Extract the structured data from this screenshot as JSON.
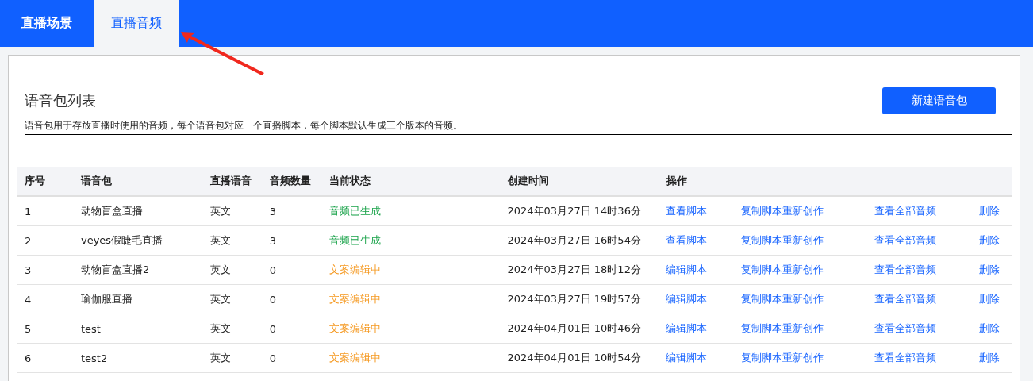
{
  "tabs": [
    {
      "label": "直播场景",
      "selected": false
    },
    {
      "label": "直播音频",
      "selected": true
    }
  ],
  "panel": {
    "title": "语音包列表",
    "description": "语音包用于存放直播时使用的音频，每个语音包对应一个直播脚本，每个脚本默认生成三个版本的音频。",
    "new_button": "新建语音包"
  },
  "table": {
    "columns": [
      "序号",
      "语音包",
      "直播语音",
      "音频数量",
      "当前状态",
      "创建时间",
      "操作"
    ],
    "rows": [
      {
        "index": "1",
        "name": "动物盲盒直播",
        "language": "英文",
        "count": "3",
        "status": {
          "kind": "done",
          "text": "音频已生成"
        },
        "created": "2024年03月27日 14时36分",
        "actions": [
          "查看脚本",
          "复制脚本重新创作",
          "查看全部音频",
          "删除"
        ]
      },
      {
        "index": "2",
        "name": "veyes假睫毛直播",
        "language": "英文",
        "count": "3",
        "status": {
          "kind": "done",
          "text": "音频已生成"
        },
        "created": "2024年03月27日 16时54分",
        "actions": [
          "查看脚本",
          "复制脚本重新创作",
          "查看全部音频",
          "删除"
        ]
      },
      {
        "index": "3",
        "name": "动物盲盒直播2",
        "language": "英文",
        "count": "0",
        "status": {
          "kind": "editing",
          "text": "文案编辑中"
        },
        "created": "2024年03月27日 18时12分",
        "actions": [
          "编辑脚本",
          "复制脚本重新创作",
          "查看全部音频",
          "删除"
        ]
      },
      {
        "index": "4",
        "name": "瑜伽服直播",
        "language": "英文",
        "count": "0",
        "status": {
          "kind": "editing",
          "text": "文案编辑中"
        },
        "created": "2024年03月27日 19时57分",
        "actions": [
          "编辑脚本",
          "复制脚本重新创作",
          "查看全部音频",
          "删除"
        ]
      },
      {
        "index": "5",
        "name": "test",
        "language": "英文",
        "count": "0",
        "status": {
          "kind": "editing",
          "text": "文案编辑中"
        },
        "created": "2024年04月01日 10时46分",
        "actions": [
          "编辑脚本",
          "复制脚本重新创作",
          "查看全部音频",
          "删除"
        ]
      },
      {
        "index": "6",
        "name": "test2",
        "language": "英文",
        "count": "0",
        "status": {
          "kind": "editing",
          "text": "文案编辑中"
        },
        "created": "2024年04月01日 10时54分",
        "actions": [
          "编辑脚本",
          "复制脚本重新创作",
          "查看全部音频",
          "删除"
        ]
      }
    ]
  }
}
